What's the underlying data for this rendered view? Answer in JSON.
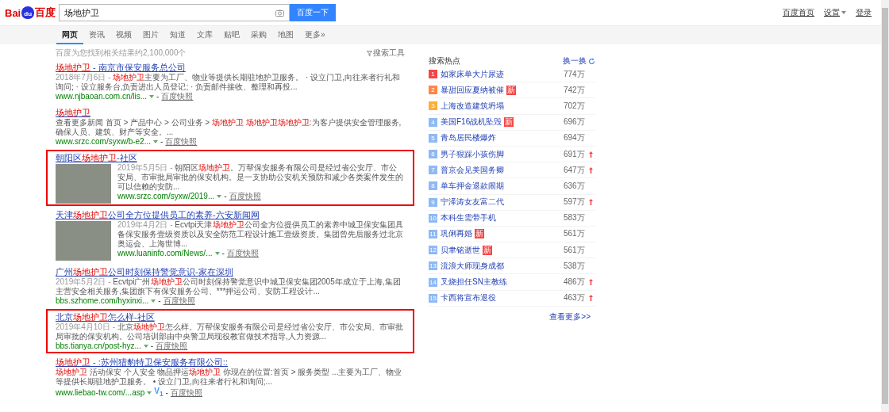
{
  "logo": {
    "left": "Bai",
    "badge": "du",
    "right": "百度"
  },
  "search": {
    "value": "场地护卫",
    "button": "百度一下"
  },
  "top_links": [
    {
      "label": "百度首页",
      "dropdown": false
    },
    {
      "label": "设置",
      "dropdown": true
    },
    {
      "label": "登录",
      "dropdown": false
    }
  ],
  "tabs": [
    {
      "label": "网页",
      "selected": true
    },
    {
      "label": "资讯",
      "selected": false
    },
    {
      "label": "视频",
      "selected": false
    },
    {
      "label": "图片",
      "selected": false
    },
    {
      "label": "知道",
      "selected": false
    },
    {
      "label": "文库",
      "selected": false
    },
    {
      "label": "贴吧",
      "selected": false
    },
    {
      "label": "采购",
      "selected": false
    },
    {
      "label": "地图",
      "selected": false
    },
    {
      "label": "更多»",
      "selected": false
    }
  ],
  "result_count": "百度为您找到相关结果约2,100,000个",
  "search_tools": "搜索工具",
  "results": [
    {
      "boxed": false,
      "image": false,
      "title": [
        {
          "text": "场地护卫",
          "highlight": true
        },
        {
          "text": " - 南京市保安服务总公司",
          "highlight": false
        }
      ],
      "date": "2018年7月6日 -",
      "abstract": [
        {
          "text": "场地护卫",
          "highlight": true
        },
        {
          "text": "主要为工厂、物业等提供长期驻地护卫服务。 · 设立门卫,向往来者行礼和询问; · 设立服务台,负责进出人员登记; · 负责邮件接收、整理和再投...",
          "highlight": false
        }
      ],
      "url": "www.njbaoan.com.cn/lis...",
      "sep": "-",
      "snapshot": "百度快照"
    },
    {
      "boxed": false,
      "image": false,
      "title": [
        {
          "text": "场地护卫",
          "highlight": true
        }
      ],
      "abstract": [
        {
          "text": "查看更多新闻 首页 > 产品中心 > 公司业务 > ",
          "highlight": false
        },
        {
          "text": "场地护卫 场地护卫场地护卫",
          "highlight": true
        },
        {
          "text": ":为客户提供安全管理服务,确保人员、建筑、财产等安全。...",
          "highlight": false
        }
      ],
      "url": "www.srzc.com/syxw/b-e2...",
      "sep": "-",
      "snapshot": "百度快照"
    },
    {
      "boxed": true,
      "image": true,
      "title": [
        {
          "text": "朝阳区",
          "highlight": false
        },
        {
          "text": "场地护卫",
          "highlight": true
        },
        {
          "text": "-社区",
          "highlight": false
        }
      ],
      "date": "2019年5月5日 -",
      "abstract": [
        {
          "text": "朝阳区",
          "highlight": false
        },
        {
          "text": "场地护卫",
          "highlight": true
        },
        {
          "text": "。万帮保安服务有限公司是经过省公安厅、市公安局、市审批局审批的保安机构。是一支协助公安机关预防和减少各类案件发生的可以信赖的安防...",
          "highlight": false
        }
      ],
      "url": "www.srzc.com/syxw/2019...",
      "sep": "-",
      "snapshot": "百度快照"
    },
    {
      "boxed": false,
      "image": true,
      "title": [
        {
          "text": "天津",
          "highlight": false
        },
        {
          "text": "场地护卫",
          "highlight": true
        },
        {
          "text": "公司全方位提供员工的素养-六安新闻网",
          "highlight": false
        }
      ],
      "date": "2019年4月2日 -",
      "abstract": [
        {
          "text": "Ecvtpi天津",
          "highlight": false
        },
        {
          "text": "场地护卫",
          "highlight": true
        },
        {
          "text": "公司全方位提供员工的素养中城卫保安集团具备保安服务壹级资质以及安全防范工程设计施工壹级资质。集团曾先后服务过北京奥运会、上海世博...",
          "highlight": false
        }
      ],
      "url": "www.luaninfo.com/News/...",
      "sep": "-",
      "snapshot": "百度快照"
    },
    {
      "boxed": false,
      "image": false,
      "title": [
        {
          "text": "广州",
          "highlight": false
        },
        {
          "text": "场地护卫",
          "highlight": true
        },
        {
          "text": "公司时刻保持警觉意识-家在深圳",
          "highlight": false
        }
      ],
      "date": "2019年5月2日 -",
      "abstract": [
        {
          "text": "Ecvtpi广州",
          "highlight": false
        },
        {
          "text": "场地护卫",
          "highlight": true
        },
        {
          "text": "公司时刻保持警觉意识中城卫保安集团2005年成立于上海,集团主营安全相关服务,集团旗下有保安服务公司、***押运公司、安防工程设计...",
          "highlight": false
        }
      ],
      "url": "bbs.szhome.com/hyxinxi...",
      "sep": "-",
      "snapshot": "百度快照"
    },
    {
      "boxed": true,
      "image": false,
      "title": [
        {
          "text": "北京",
          "highlight": false
        },
        {
          "text": "场地护卫",
          "highlight": true
        },
        {
          "text": "怎么样-社区",
          "highlight": false
        }
      ],
      "date": "2019年4月10日 -",
      "abstract": [
        {
          "text": "北京",
          "highlight": false
        },
        {
          "text": "场地护卫",
          "highlight": true
        },
        {
          "text": "怎么样。万帮保安服务有限公司是经过省公安厅、市公安局、市审批局审批的保安机构。公司培训部由中央警卫局现役教官做技术指导,人力资源...",
          "highlight": false
        }
      ],
      "url": "bbs.tianya.cn/post-hyz...",
      "sep": "-",
      "snapshot": "百度快照"
    },
    {
      "boxed": false,
      "image": false,
      "title": [
        {
          "text": "场地护卫",
          "highlight": true
        },
        {
          "text": " - :苏州猎豹特卫保安服务有限公司::",
          "highlight": false
        }
      ],
      "abstract": [
        {
          "text": "场地护卫",
          "highlight": true
        },
        {
          "text": " 活动保安 个人安全 物品押运",
          "highlight": false
        },
        {
          "text": "场地护卫",
          "highlight": true
        },
        {
          "text": " 你现在的位置:首页 > 服务类型 ...主要为工厂、物业等提供长期驻地护卫服务。 • 设立门卫,向往来者行礼和询问;...",
          "highlight": false
        }
      ],
      "url": "www.liebao-tw.com/...asp",
      "badge": "V$_{1}$",
      "sep": "-",
      "snapshot": "百度快照"
    }
  ],
  "hot": {
    "title": "搜索热点",
    "refresh": "换一换",
    "more": "查看更多>>",
    "items": [
      {
        "rank": "1",
        "title": "如家床单大片尿迹",
        "count": "774万",
        "rising": false,
        "color": "#f54545"
      },
      {
        "rank": "2",
        "title": "暴甜回应夏纳被催",
        "badge": "新",
        "count": "742万",
        "rising": false,
        "color": "#ff8547"
      },
      {
        "rank": "3",
        "title": "上海改造建筑坍塌",
        "count": "702万",
        "rising": false,
        "color": "#ffac38"
      },
      {
        "rank": "4",
        "title": "美国F16战机坠毁",
        "badge": "新",
        "count": "696万",
        "rising": false,
        "color": "#8eb9f5"
      },
      {
        "rank": "5",
        "title": "青岛居民楼爆炸",
        "count": "694万",
        "rising": false,
        "color": "#8eb9f5"
      },
      {
        "rank": "6",
        "title": "男子狠踩小孩伤脚",
        "count": "691万",
        "rising": true,
        "color": "#8eb9f5"
      },
      {
        "rank": "7",
        "title": "普京会见美国务卿",
        "count": "647万",
        "rising": true,
        "color": "#8eb9f5"
      },
      {
        "rank": "8",
        "title": "单车押金退款闹期",
        "count": "636万",
        "rising": false,
        "color": "#8eb9f5"
      },
      {
        "rank": "9",
        "title": "宁泽涛女友富二代",
        "count": "597万",
        "rising": true,
        "color": "#8eb9f5"
      },
      {
        "rank": "10",
        "title": "本科生需带手机",
        "count": "583万",
        "rising": false,
        "color": "#8eb9f5"
      },
      {
        "rank": "11",
        "title": "巩俐再婚",
        "badge": "新",
        "count": "561万",
        "rising": false,
        "color": "#8eb9f5"
      },
      {
        "rank": "12",
        "title": "贝聿铭逝世",
        "badge": "新",
        "count": "561万",
        "rising": false,
        "color": "#8eb9f5"
      },
      {
        "rank": "13",
        "title": "流浪大师现身成都",
        "count": "538万",
        "rising": false,
        "color": "#8eb9f5"
      },
      {
        "rank": "14",
        "title": "叉烧担任SN主教练",
        "count": "486万",
        "rising": true,
        "color": "#8eb9f5"
      },
      {
        "rank": "15",
        "title": "卡西将宣布退役",
        "count": "463万",
        "rising": true,
        "color": "#8eb9f5"
      }
    ]
  }
}
